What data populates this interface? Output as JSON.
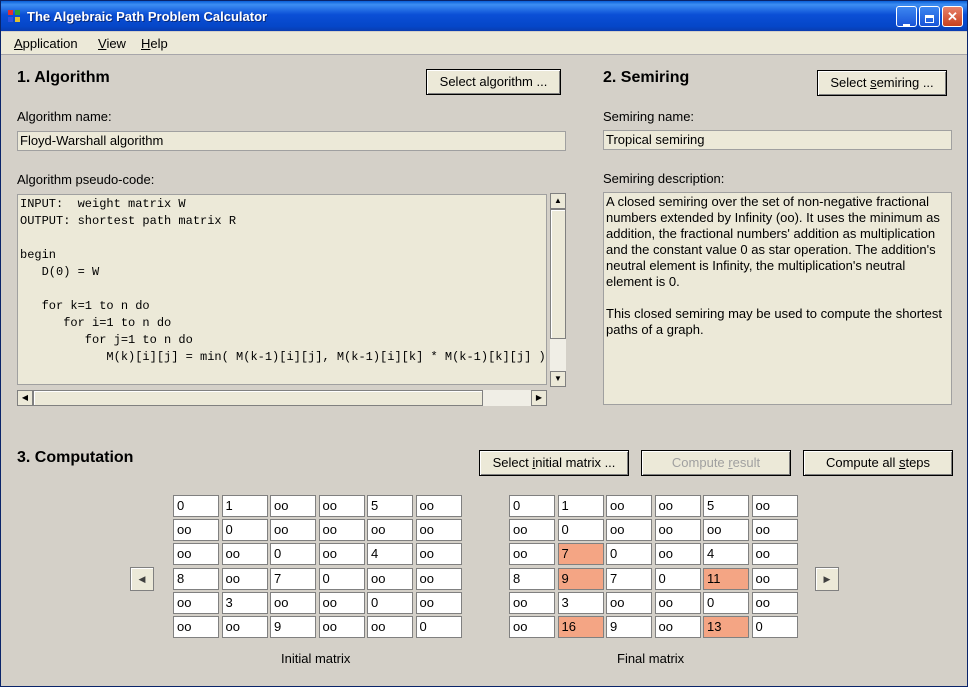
{
  "window": {
    "title": "The Algebraic Path Problem Calculator"
  },
  "menu": [
    {
      "label_u": "A",
      "label_rest": "pplication"
    },
    {
      "label_u": "V",
      "label_rest": "iew"
    },
    {
      "label_u": "H",
      "label_rest": "elp"
    }
  ],
  "algorithm": {
    "section_title": "1. Algorithm",
    "select_button": {
      "pre": "Select al",
      "u": "g",
      "post": "orithm ..."
    },
    "name_label": "Algorithm name:",
    "name": "Floyd-Warshall algorithm",
    "pseudo_label": "Algorithm pseudo-code:",
    "pseudo_code": "INPUT:  weight matrix W\nOUTPUT: shortest path matrix R\n\nbegin\n   D(0) = W\n\n   for k=1 to n do\n      for i=1 to n do\n         for j=1 to n do\n            M(k)[i][j] = min( M(k-1)[i][j], M(k-1)[i][k] * M(k-1)[k][j] )"
  },
  "semiring": {
    "section_title": "2. Semiring",
    "select_button": {
      "pre": "Select ",
      "u": "s",
      "post": "emiring ..."
    },
    "name_label": "Semiring name:",
    "name": "Tropical semiring",
    "desc_label": "Semiring description:",
    "description_p1": "A closed semiring over the set of non-negative fractional numbers extended by Infinity (oo). It uses the minimum as addition, the fractional numbers' addition as multiplication and the constant value 0 as star operation. The addition's neutral element is Infinity, the multiplication's neutral element is 0.",
    "description_p2": "This closed semiring may be used to compute the shortest paths of a graph."
  },
  "computation": {
    "section_title": "3. Computation",
    "select_initial_button": {
      "pre": "Select ",
      "u": "i",
      "post": "nitial matrix ..."
    },
    "compute_result_button": {
      "pre": "Compute ",
      "u": "r",
      "post": "esult"
    },
    "compute_all_button": {
      "pre": "Compute all ",
      "u": "s",
      "post": "teps"
    },
    "initial_caption": "Initial matrix",
    "final_caption": "Final matrix",
    "initial_matrix": [
      [
        "0",
        "1",
        "oo",
        "oo",
        "5",
        "oo"
      ],
      [
        "oo",
        "0",
        "oo",
        "oo",
        "oo",
        "oo"
      ],
      [
        "oo",
        "oo",
        "0",
        "oo",
        "4",
        "oo"
      ],
      [
        "8",
        "oo",
        "7",
        "0",
        "oo",
        "oo"
      ],
      [
        "oo",
        "3",
        "oo",
        "oo",
        "0",
        "oo"
      ],
      [
        "oo",
        "oo",
        "9",
        "oo",
        "oo",
        "0"
      ]
    ],
    "final_matrix": [
      [
        "0",
        "1",
        "oo",
        "oo",
        "5",
        "oo"
      ],
      [
        "oo",
        "0",
        "oo",
        "oo",
        "oo",
        "oo"
      ],
      [
        "oo",
        "7",
        "0",
        "oo",
        "4",
        "oo"
      ],
      [
        "8",
        "9",
        "7",
        "0",
        "11",
        "oo"
      ],
      [
        "oo",
        "3",
        "oo",
        "oo",
        "0",
        "oo"
      ],
      [
        "oo",
        "16",
        "9",
        "oo",
        "13",
        "0"
      ]
    ],
    "final_highlighted": [
      [
        2,
        1
      ],
      [
        3,
        1
      ],
      [
        3,
        4
      ],
      [
        5,
        1
      ],
      [
        5,
        4
      ]
    ],
    "highlight_color": "#f4a584"
  }
}
